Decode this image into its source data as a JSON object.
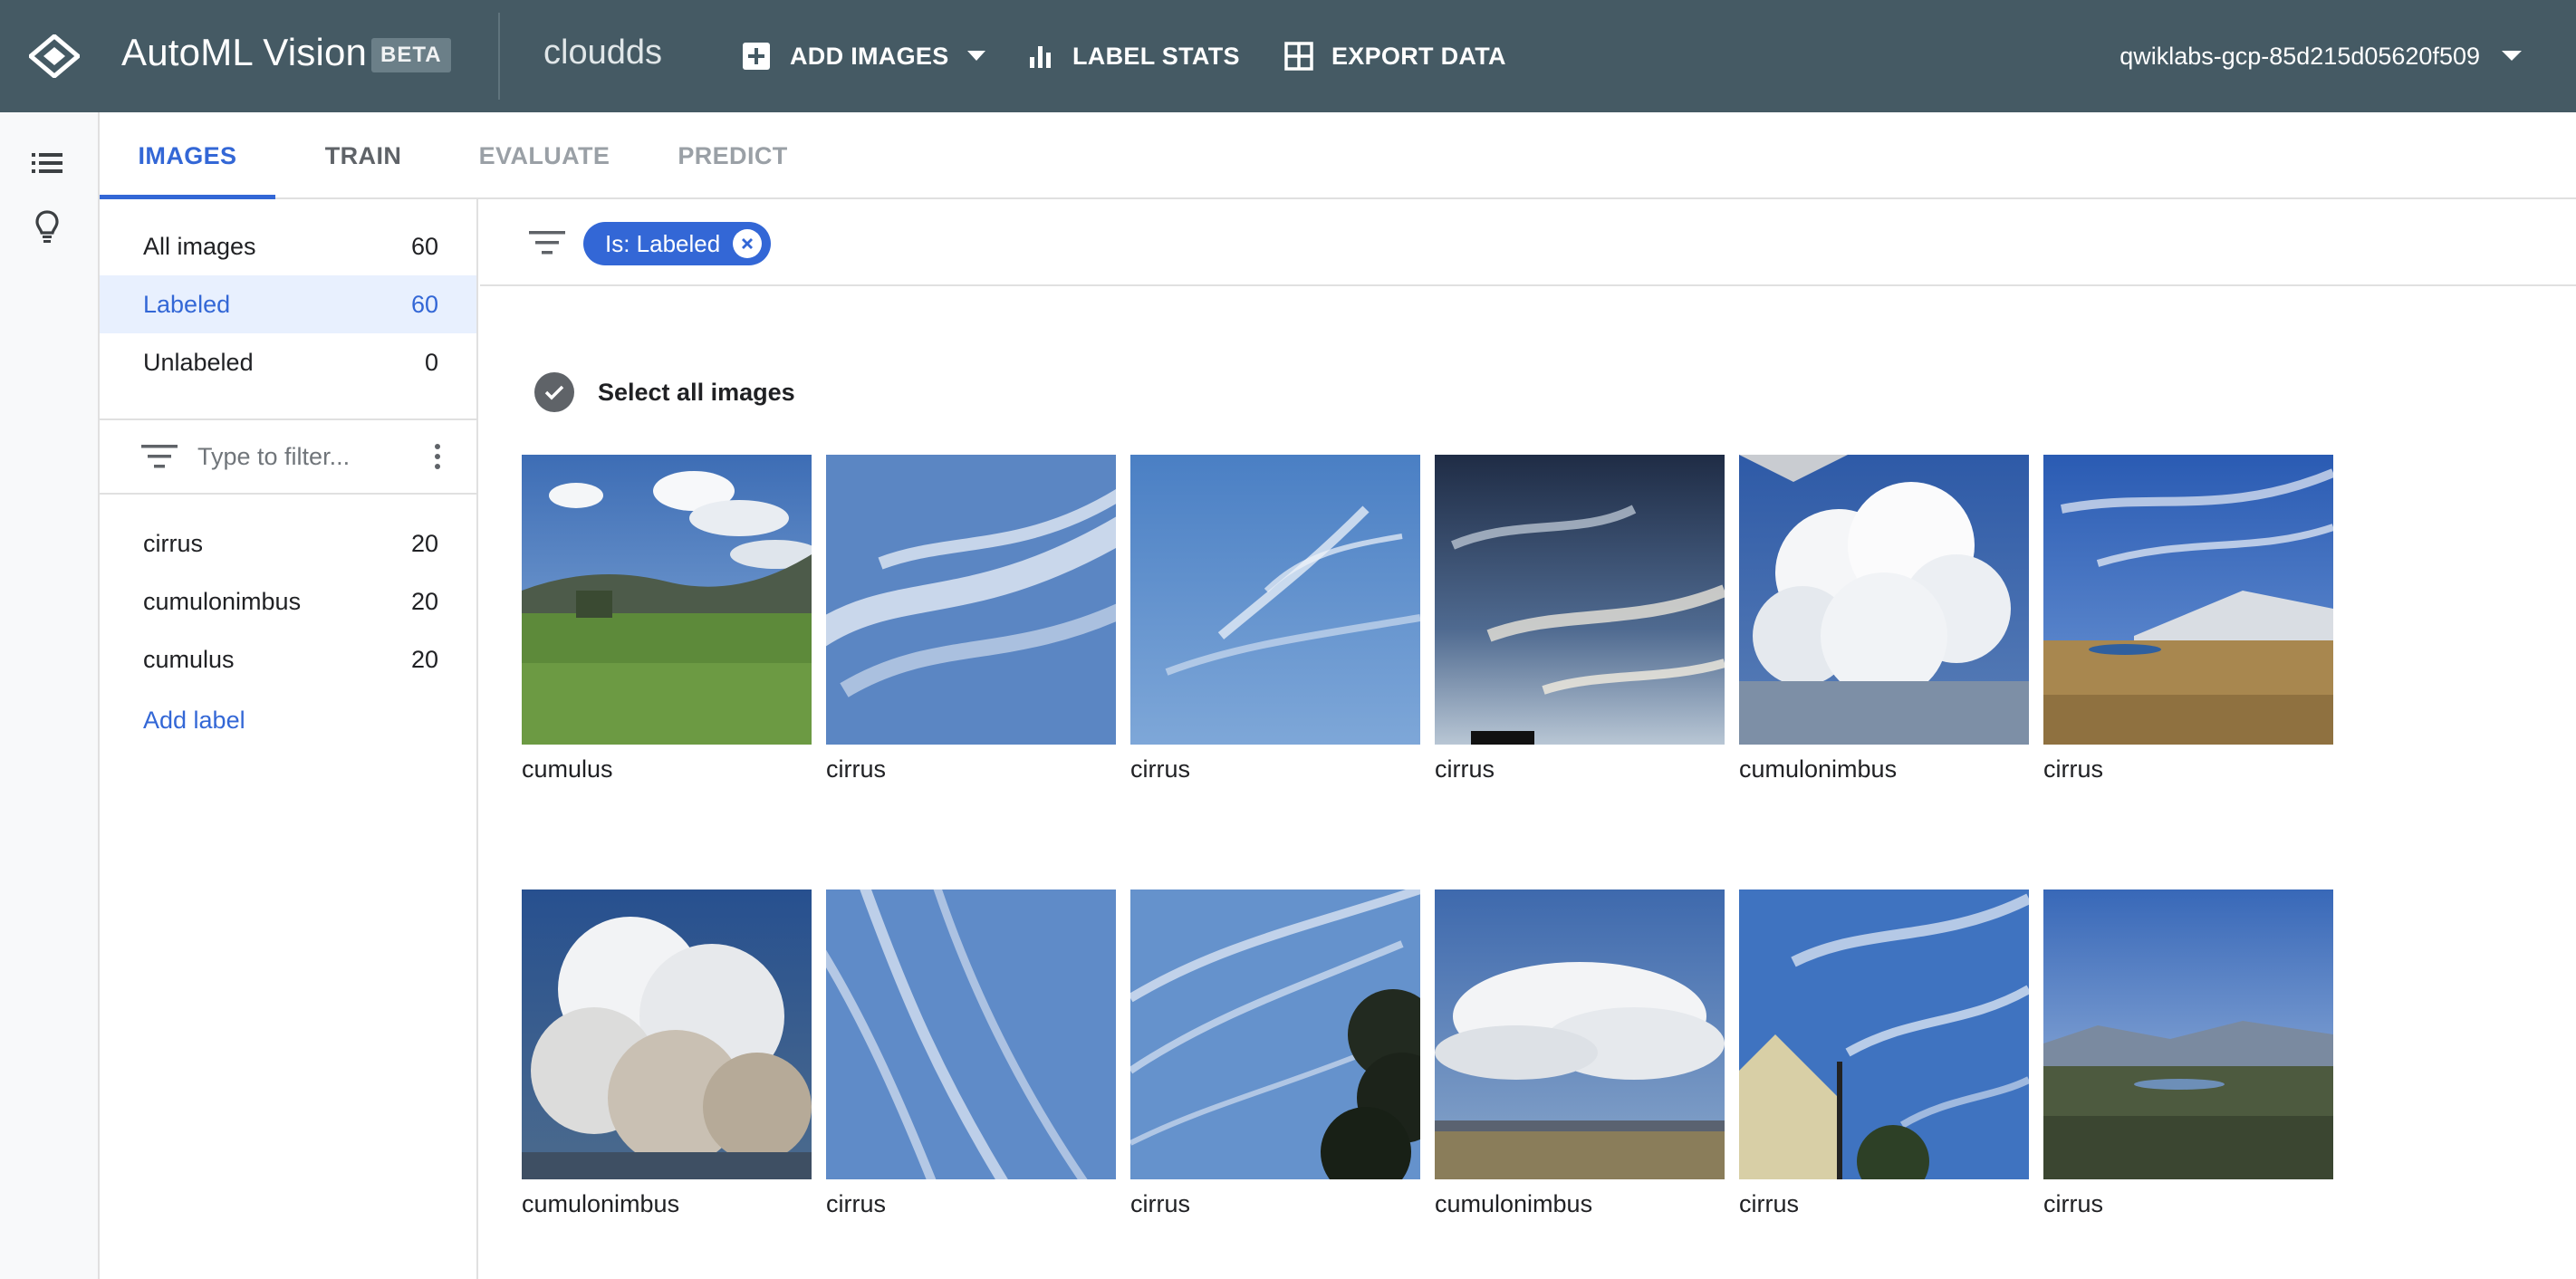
{
  "header": {
    "app_title": "AutoML Vision",
    "badge": "BETA",
    "dataset": "cloudds",
    "buttons": {
      "add_images": "ADD IMAGES",
      "label_stats": "LABEL STATS",
      "export_data": "EXPORT DATA"
    },
    "account": "qwiklabs-gcp-85d215d05620f509",
    "color": "#455a64"
  },
  "rail": {
    "icons": [
      "list-icon",
      "lightbulb-icon"
    ]
  },
  "tabs": [
    {
      "label": "IMAGES",
      "state": "active"
    },
    {
      "label": "TRAIN",
      "state": "normal"
    },
    {
      "label": "EVALUATE",
      "state": "disabled"
    },
    {
      "label": "PREDICT",
      "state": "disabled"
    }
  ],
  "sidebar": {
    "status_filters": [
      {
        "label": "All images",
        "count": "60"
      },
      {
        "label": "Labeled",
        "count": "60"
      },
      {
        "label": "Unlabeled",
        "count": "0"
      }
    ],
    "selected_filter": "Labeled",
    "filter_placeholder": "Type to filter...",
    "labels": [
      {
        "label": "cirrus",
        "count": "20"
      },
      {
        "label": "cumulonimbus",
        "count": "20"
      },
      {
        "label": "cumulus",
        "count": "20"
      }
    ],
    "add_label": "Add label"
  },
  "filter_chip": "Is: Labeled",
  "select_all": "Select all images",
  "images": [
    {
      "label": "cumulus",
      "scene": "field"
    },
    {
      "label": "cirrus",
      "scene": "wisp"
    },
    {
      "label": "cirrus",
      "scene": "wisp-blue"
    },
    {
      "label": "cirrus",
      "scene": "dusk"
    },
    {
      "label": "cumulonimbus",
      "scene": "tower"
    },
    {
      "label": "cirrus",
      "scene": "mountain"
    },
    {
      "label": "cumulonimbus",
      "scene": "storm"
    },
    {
      "label": "cirrus",
      "scene": "streaks"
    },
    {
      "label": "cirrus",
      "scene": "tree"
    },
    {
      "label": "cumulonimbus",
      "scene": "plain"
    },
    {
      "label": "cirrus",
      "scene": "building"
    },
    {
      "label": "cirrus",
      "scene": "valley"
    }
  ],
  "colors": {
    "accent": "#3367d6",
    "selected_bg": "#e8f0fe"
  }
}
